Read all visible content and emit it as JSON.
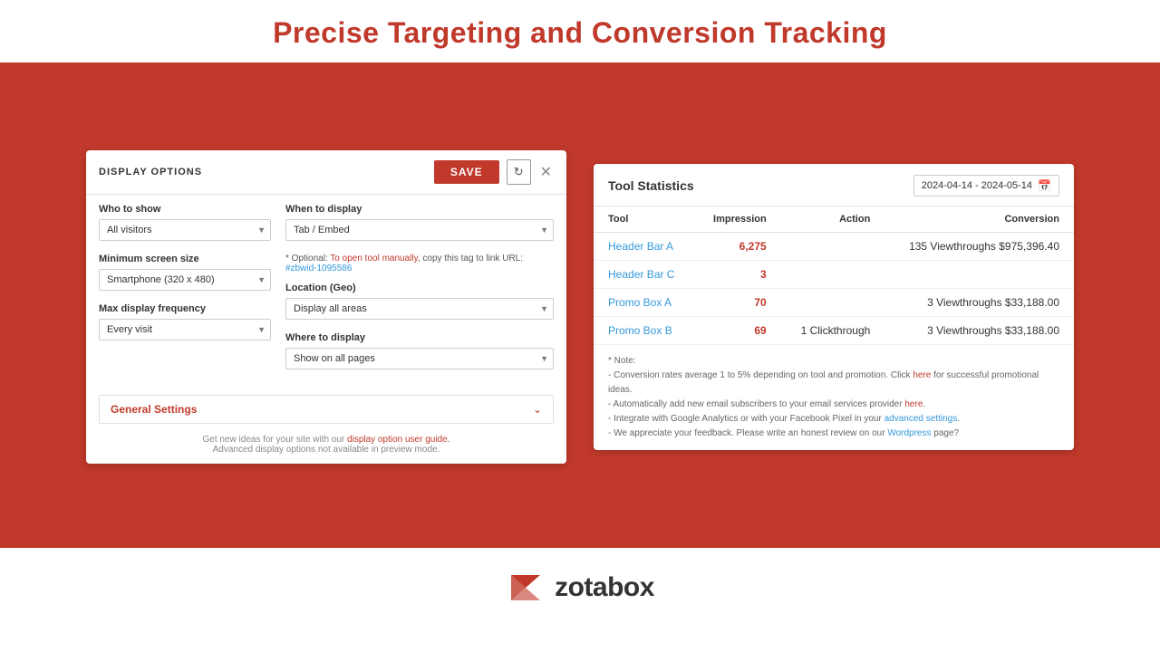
{
  "header": {
    "title": "Precise Targeting and Conversion Tracking"
  },
  "display_options": {
    "panel_title": "DISPLAY OPTIONS",
    "save_label": "SAVE",
    "who_to_show": {
      "label": "Who to show",
      "value": "All visitors"
    },
    "min_screen": {
      "label": "Minimum screen size",
      "value": "Smartphone (320 x 480)"
    },
    "max_frequency": {
      "label": "Max display frequency",
      "value": "Every visit"
    },
    "when_to_display": {
      "label": "When to display",
      "value": "Tab / Embed"
    },
    "optional_note": "* Optional: To open tool manually, copy this tag to link URL:",
    "tag_link": "#zbwid-1095586",
    "location_geo": {
      "label": "Location (Geo)",
      "value": "Display all areas"
    },
    "where_to_display": {
      "label": "Where to display",
      "value": "Show on all pages"
    },
    "general_settings_label": "General Settings",
    "footer_text": "Get new ideas for your site with our",
    "footer_link_text": "display option user guide.",
    "footer_text2": "Advanced display options not available in preview mode."
  },
  "tool_statistics": {
    "title": "Tool Statistics",
    "date_range": "2024-04-14 - 2024-05-14",
    "columns": [
      "Tool",
      "Impression",
      "Action",
      "Conversion"
    ],
    "rows": [
      {
        "tool": "Header Bar A",
        "impression": "6,275",
        "action": "",
        "conversion": "135 Viewthroughs $975,396.40"
      },
      {
        "tool": "Header Bar C",
        "impression": "3",
        "action": "",
        "conversion": ""
      },
      {
        "tool": "Promo Box A",
        "impression": "70",
        "action": "",
        "conversion": "3 Viewthroughs $33,188.00"
      },
      {
        "tool": "Promo Box B",
        "impression": "69",
        "action": "1 Clickthrough",
        "conversion": "3 Viewthroughs $33,188.00"
      }
    ],
    "note_lines": [
      "* Note:",
      "- Conversion rates average 1 to 5% depending on tool and promotion. Click here for successful promotional ideas.",
      "- Automatically add new email subscribers to your email services provider here.",
      "- Integrate with Google Analytics or with your Facebook Pixel in your advanced settings.",
      "- We appreciate your feedback. Please write an honest review on our Wordpress page?"
    ]
  },
  "footer": {
    "logo_text": "zotabox"
  }
}
